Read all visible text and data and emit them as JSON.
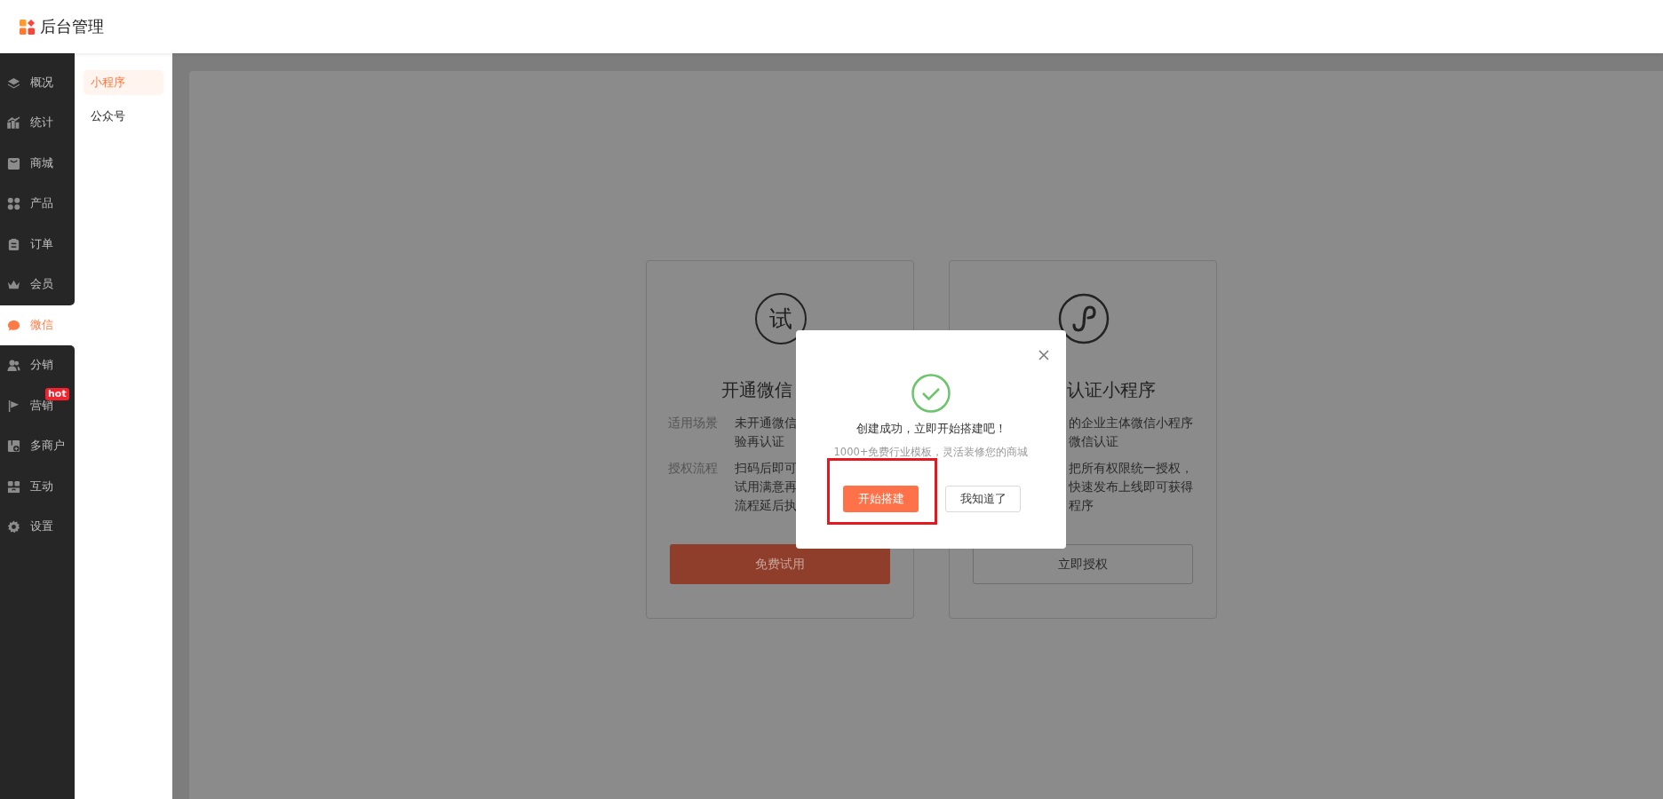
{
  "header": {
    "title": "后台管理"
  },
  "sidebar": {
    "items": [
      {
        "label": "概况",
        "selected": false
      },
      {
        "label": "统计",
        "selected": false
      },
      {
        "label": "商城",
        "selected": false
      },
      {
        "label": "产品",
        "selected": false
      },
      {
        "label": "订单",
        "selected": false
      },
      {
        "label": "会员",
        "selected": false
      },
      {
        "label": "微信",
        "selected": true
      },
      {
        "label": "分销",
        "selected": false
      },
      {
        "label": "营销",
        "selected": false,
        "badge": "hot"
      },
      {
        "label": "多商户",
        "selected": false
      },
      {
        "label": "互动",
        "selected": false
      },
      {
        "label": "设置",
        "selected": false
      }
    ]
  },
  "submenu": {
    "items": [
      {
        "label": "小程序",
        "selected": true
      },
      {
        "label": "公众号",
        "selected": false
      }
    ]
  },
  "cards": [
    {
      "kind": "trial",
      "icon_text": "试",
      "title": "开通微信",
      "rows": [
        {
          "label": "适用场景",
          "lines": [
            "未开通微信",
            "验再认证"
          ]
        },
        {
          "label": "授权流程",
          "lines": [
            "扫码后即可",
            "试用满意再",
            "流程延后执"
          ]
        }
      ],
      "button": "免费试用"
    },
    {
      "kind": "auth",
      "title": "认证小程序",
      "rows": [
        {
          "lines": [
            "的企业主体微信小程序",
            "微信认证"
          ]
        },
        {
          "lines": [
            "把所有权限统一授权，",
            "快速发布上线即可获得",
            "程序"
          ]
        }
      ],
      "button": "立即授权"
    }
  ],
  "modal": {
    "message": "创建成功，立即开始搭建吧！",
    "hint": "1000+免费行业模板，灵活装修您的商城",
    "buttons": [
      {
        "label": "开始搭建",
        "kind": "primary",
        "highlighted": true
      },
      {
        "label": "我知道了",
        "kind": "default",
        "highlighted": false
      }
    ]
  }
}
